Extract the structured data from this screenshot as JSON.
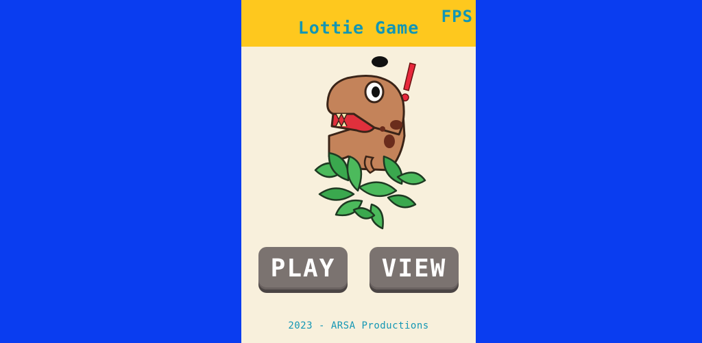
{
  "header": {
    "title": "Lottie Game",
    "fps_label": "FPS"
  },
  "menu": {
    "play_label": "PLAY",
    "view_label": "VIEW"
  },
  "footer": {
    "credits": "2023 - ARSA Productions"
  },
  "colors": {
    "background": "#0a3df0",
    "panel": "#f8f0dc",
    "header": "#fec81e",
    "accent_text": "#1296b4",
    "button": "#7b7370"
  }
}
